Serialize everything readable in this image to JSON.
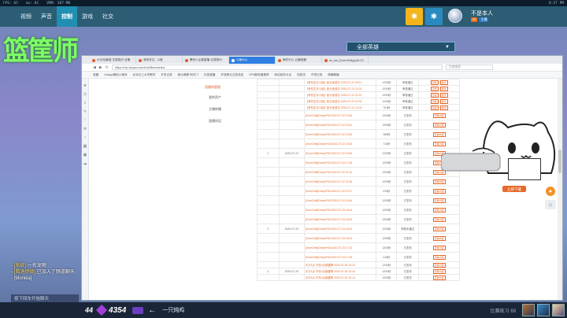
{
  "status_bar": {
    "left_items": [
      "FPS: 65",
      "ms: 6C",
      "VRM: 387 MB"
    ],
    "clock": "8:27 PM"
  },
  "top_nav": {
    "items": [
      "视频",
      "声音",
      "控制",
      "游戏",
      "社交"
    ],
    "active_index": 2
  },
  "user": {
    "name": "不是本人",
    "badges": [
      "99",
      "主播"
    ]
  },
  "logo_text": "篮筐师",
  "hero_select": {
    "value": "全部英雄"
  },
  "browser": {
    "tabs": [
      "a7论坛最强·无畏契约·合集·",
      "我的关注 - 斗鱼",
      "腾讯小企鹅直播·无畏契约·",
      "斗鱼中心",
      "案件中心-云播放器",
      "ev_ctd_(OverOrbit)pp46 2C"
    ],
    "active_tab_index": 3,
    "url": "https://mp.douyu.com/tool/filemachine",
    "search_placeholder": "百度搜索",
    "bookmarks": [
      "收藏",
      "Uniapp微信小程序",
      "北京社工大学教材",
      "开发记录",
      "超大佛教·阿乐门",
      "抖音直播",
      "开放职业文档总结",
      "VPN服务器推荐",
      "网站相关大全",
      "信息流",
      "开发记录",
      "精编精编"
    ]
  },
  "page": {
    "menu_header": "直播间管理",
    "menu_items": [
      "我的资产",
      "主播转播",
      "直播间设"
    ],
    "rows": [
      {
        "idx": "",
        "date": "",
        "link": "【有机生存小组】影分身游击 2020-07-21 09:13",
        "dur": "1200秒",
        "status": "审核通过",
        "acts": [
          "回放",
          "发布"
        ]
      },
      {
        "idx": "",
        "date": "",
        "link": "【有机生存小组】影分身游击 2020-07-21 10:31",
        "dur": "1200秒",
        "status": "审核通过",
        "acts": [
          "回放",
          "发布"
        ]
      },
      {
        "idx": "",
        "date": "",
        "link": "【有机生存小组】影分身游击 2020-07-21 11:22",
        "dur": "1200秒",
        "status": "审核通过",
        "acts": [
          "回放",
          "发布"
        ]
      },
      {
        "idx": "",
        "date": "",
        "link": "【有机生存小组】影分身游击 2020-07-21 12:02",
        "dur": "1200秒",
        "status": "审核通过",
        "acts": [
          "回放",
          "发布"
        ]
      },
      {
        "idx": "",
        "date": "",
        "link": "【有机生存小组】影分身游击 2020-07-21 14:32",
        "dur": "761秒",
        "status": "审核通过",
        "acts": [
          "回放",
          "发布"
        ]
      },
      {
        "idx": "",
        "date": "",
        "link": "[OverOrbit]OverpP46 2020-07-22 14:43",
        "dur": "1200秒",
        "status": "已发布",
        "acts": [
          "查看内容"
        ]
      },
      {
        "idx": "",
        "date": "",
        "link": "[OverOrbit]OverpP46 2020-07-22 15:11",
        "dur": "1200秒",
        "status": "已发布",
        "acts": [
          "查看内容"
        ]
      },
      {
        "idx": "",
        "date": "",
        "link": "[OverOrbit]OverpP46 2020-07-22 15:26",
        "dur": "360秒",
        "status": "已发布",
        "acts": [
          "查看内容"
        ]
      },
      {
        "idx": "",
        "date": "",
        "link": "[OverOrbit]OverpP46 2020-07-22 16:03",
        "dur": "710秒",
        "status": "已发布",
        "acts": [
          "查看内容"
        ]
      },
      {
        "idx": "2",
        "date": "2020-07-22",
        "link": "[OverOrbit]OverpP46 2020-07-22 16:54",
        "dur": "1200秒",
        "status": "已发布",
        "acts": [
          "查看内容"
        ]
      },
      {
        "idx": "",
        "date": "",
        "link": "[OverOrbit]OverpP46 2020-07-22 17:26",
        "dur": "1200秒",
        "status": "已发布",
        "acts": [
          "查看内容"
        ]
      },
      {
        "idx": "",
        "date": "",
        "link": "[OverOrbit]OverpP46 2020-07-22 21:14",
        "dur": "1200秒",
        "status": "已发布",
        "acts": [
          "查看内容"
        ]
      },
      {
        "idx": "",
        "date": "",
        "link": "[OverOrbit]OverpP46 2020-07-22 21:45",
        "dur": "1200秒",
        "status": "已发布",
        "acts": [
          "查看内容"
        ]
      },
      {
        "idx": "",
        "date": "",
        "link": "[OverOrbit]OverpP46 2020-07-22 22:17",
        "dur": "415秒",
        "status": "已发布",
        "acts": [
          "查看内容"
        ]
      },
      {
        "idx": "",
        "date": "",
        "link": "[OverOrbit]OverpP46 2020-07-23 14:44",
        "dur": "1200秒",
        "status": "已发布",
        "acts": [
          "查看内容"
        ]
      },
      {
        "idx": "",
        "date": "",
        "link": "[OverOrbit]OverpP46 2020-07-23 15:14",
        "dur": "1200秒",
        "status": "已发布",
        "acts": [
          "查看内容"
        ]
      },
      {
        "idx": "",
        "date": "",
        "link": "[OverOrbit]OverpP46 2020-07-23 15:43",
        "dur": "1200秒",
        "status": "已发布",
        "acts": [
          "查看内容"
        ]
      },
      {
        "idx": "3",
        "date": "2020-07-23",
        "link": "[OverOrbit]OverpP46 2020-07-23 16:13",
        "dur": "1200秒",
        "status": "审核未通过",
        "acts": [
          "查看内容"
        ]
      },
      {
        "idx": "",
        "date": "",
        "link": "[OverOrbit]OverpP46 2020-07-23 16:43",
        "dur": "1200秒",
        "status": "已发布",
        "acts": [
          "查看内容"
        ]
      },
      {
        "idx": "",
        "date": "",
        "link": "[OverOrbit]OverpP46 2020-07-23 17:13",
        "dur": "1200秒",
        "status": "已发布",
        "acts": [
          "查看内容"
        ]
      },
      {
        "idx": "",
        "date": "",
        "link": "[OverOrbit]OverpP46 2020-07-23 17:43",
        "dur": "415秒",
        "status": "已发布",
        "acts": [
          "查看内容"
        ]
      },
      {
        "idx": "",
        "date": "",
        "link": "天才4点·不怕4点被雷劈 2020-07-25 14:12",
        "dur": "1200秒",
        "status": "已发布",
        "acts": [
          "查看内容"
        ]
      },
      {
        "idx": "4",
        "date": "2020-07-25",
        "link": "天才4点·不怕4点被雷劈 2020-07-25 14:42",
        "dur": "1200秒",
        "status": "已发布",
        "acts": [
          "查看内容"
        ]
      },
      {
        "idx": "",
        "date": "",
        "link": "天才4点·不怕4点被雷劈 2020-07-25 15:12",
        "dur": "1200秒",
        "status": "已发布",
        "acts": [
          "查看内容"
        ]
      }
    ]
  },
  "overlay": {
    "cat_button": "立即下载"
  },
  "chat": {
    "lines": [
      {
        "prefix": "[系统]",
        "text": "一名宠物"
      },
      {
        "prefix": "[弗洛伊德]",
        "text": "已加入了频道聊天"
      },
      {
        "prefix": "",
        "text": "[Monika]"
      }
    ],
    "input_placeholder": "按下回车开始聊天"
  },
  "bottom_bar": {
    "level": "44",
    "score": "4354",
    "player_name": "一只炖鸡",
    "match_time": "比赛练习 69"
  }
}
